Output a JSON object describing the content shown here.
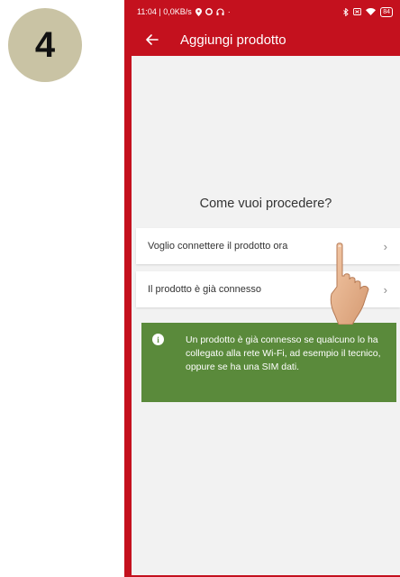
{
  "step": {
    "number": "4"
  },
  "status_bar": {
    "time_and_speed": "11:04 | 0,0KB/s",
    "battery": "84"
  },
  "app_bar": {
    "title": "Aggiungi prodotto"
  },
  "main": {
    "question": "Come vuoi procedere?",
    "options": [
      {
        "label": "Voglio connettere il prodotto ora"
      },
      {
        "label": "Il prodotto è già connesso"
      }
    ],
    "info": {
      "text": "Un prodotto è già connesso se qualcuno lo ha collegato alla rete Wi-Fi, ad esempio il tecnico, oppure se ha una SIM dati."
    }
  },
  "colors": {
    "brand_red": "#c4111e",
    "info_green": "#5a8a3b",
    "badge_beige": "#c9c3a4",
    "background": "#f2f2f2"
  },
  "icons": {
    "back": "arrow-left-icon",
    "chevron": "chevron-right-icon",
    "info": "info-icon",
    "pointer": "pointing-hand-icon"
  }
}
